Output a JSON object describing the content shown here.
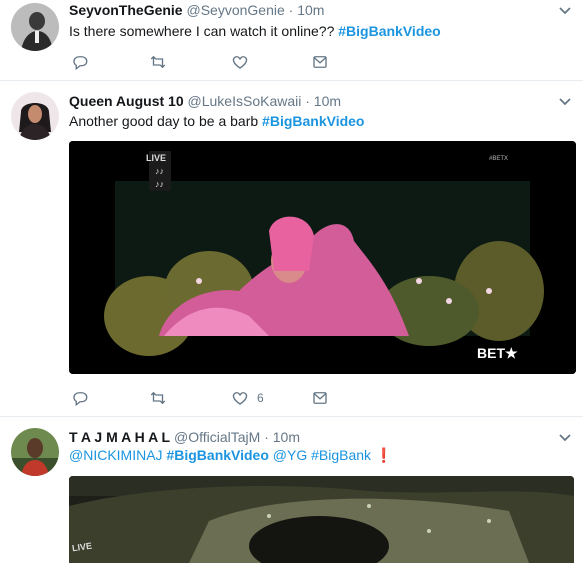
{
  "tweets": [
    {
      "name": "SeyvonTheGenie",
      "handle": "@SeyvonGenie",
      "dot": "·",
      "time": "10m",
      "text_plain": "Is there somewhere I can watch it online?? ",
      "hashtag": "#BigBankVideo"
    },
    {
      "name": "Queen August 10",
      "handle": "@LukeIsSoKawaii",
      "dot": "·",
      "time": "10m",
      "text_plain": "Another good day to be a barb ",
      "hashtag": "#BigBankVideo",
      "video": {
        "live_label": "LIVE",
        "corner_tag": "#BETX",
        "notes": "♪♪",
        "logo": "BET★"
      },
      "like_count": "6"
    },
    {
      "name": "T A J M A H A L",
      "handle": "@OfficialTajM",
      "dot": "·",
      "time": "10m",
      "mention1": "@NICKIMINAJ",
      "hashtag": "#BigBankVideo",
      "mention2": "@YG",
      "hashtag2": "#BigBank",
      "emoji": "❗",
      "video": {
        "live_label": "LIVE"
      }
    }
  ],
  "icons": {
    "reply": "reply-icon",
    "retweet": "retweet-icon",
    "like": "heart-icon",
    "dm": "envelope-icon",
    "caret": "chevron-down-icon"
  },
  "colors": {
    "link": "#1b95e0",
    "muted": "#657786",
    "divider": "#e6ecf0"
  }
}
